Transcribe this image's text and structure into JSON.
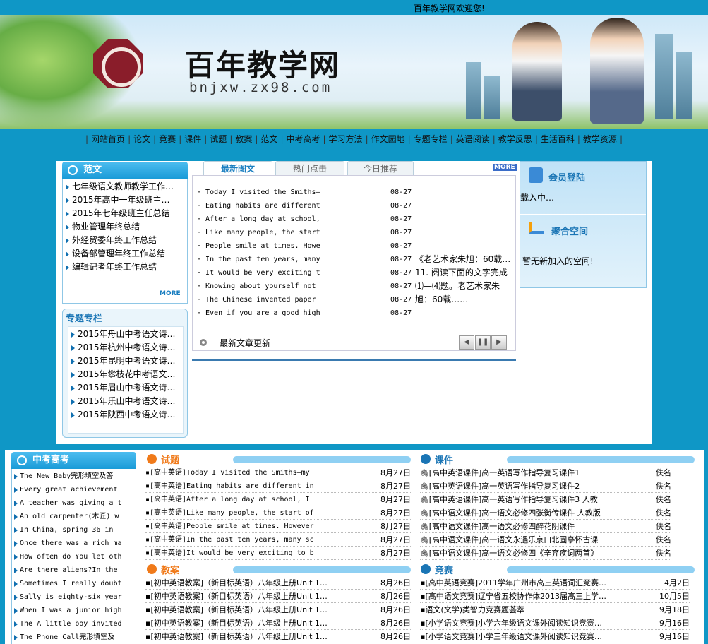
{
  "header": {
    "welcome": "百年教学网欢迎您!",
    "site_title": "百年教学网",
    "site_url": "bnjxw.zx98.com"
  },
  "nav": [
    "网站首页",
    "论文",
    "竞赛",
    "课件",
    "试题",
    "教案",
    "范文",
    "中考高考",
    "学习方法",
    "作文园地",
    "专题专栏",
    "英语阅读",
    "教学反思",
    "生活百科",
    "教学资源"
  ],
  "fanwen": {
    "title": "范文",
    "more": "MORE",
    "items": [
      "七年级语文教师教学工作…",
      "2015年高中一年级班主任…",
      "2015年七年级班主任总结",
      "物业管理年终总结",
      "外经贸委年终工作总结",
      "设备部管理年终工作总结",
      "编辑记者年终工作总结"
    ]
  },
  "zhuanti": {
    "title": "专题专栏",
    "items": [
      "2015年舟山中考语文诗词…",
      "2015年杭州中考语文诗词…",
      "2015年昆明中考语文诗词…",
      "2015年攀枝花中考语文诗…",
      "2015年眉山中考语文诗词…",
      "2015年乐山中考语文诗词…",
      "2015年陕西中考语文诗词…"
    ]
  },
  "tabs": [
    "最新图文",
    "热门点击",
    "今日推荐"
  ],
  "tab_more": "MORE",
  "news": {
    "items": [
      {
        "title": "Today I visited the Smiths—",
        "date": "08-27"
      },
      {
        "title": "Eating habits are different",
        "date": "08-27"
      },
      {
        "title": "After a long day at school,",
        "date": "08-27"
      },
      {
        "title": "Like many people, the start",
        "date": "08-27"
      },
      {
        "title": "People smile at times. Howe",
        "date": "08-27"
      },
      {
        "title": "In the past ten years, many",
        "date": "08-27"
      },
      {
        "title": "It would be very exciting t",
        "date": "08-27"
      },
      {
        "title": "Knowing about yourself not",
        "date": "08-27"
      },
      {
        "title": "The Chinese invented paper",
        "date": "08-27"
      },
      {
        "title": "Even if you are a good high",
        "date": "08-27"
      }
    ],
    "side_text": [
      "《老艺术家朱旭：60载…",
      "11. 阅读下面的文字完成",
      "⑴—⑷题。老艺术家朱",
      "旭：60载……"
    ],
    "footer": "最新文章更新",
    "ctrl_prev": "◀",
    "ctrl_pause": "❚❚",
    "ctrl_next": "▶"
  },
  "member": {
    "title": "会员登陆",
    "loading": "载入中…",
    "space_title": "聚合空间",
    "space_empty": "暂无新加入的空间!"
  },
  "zhongkao": {
    "title": "中考高考",
    "items": [
      "The New Baby完形填空及答",
      "Every great achievement",
      "A teacher was giving a t",
      "An old carpenter(木匠) w",
      "In China, spring  36  in",
      "Once there was a rich ma",
      "How often do You let oth",
      "Are there aliens?In the",
      "Sometimes I really doubt",
      "Sally is eighty-six year",
      "When I was a junior high",
      "The A little boy invited",
      "The Phone Call完形填空及"
    ]
  },
  "shiti": {
    "title": "试题",
    "items": [
      {
        "title": "▪[高中英语]Today I visited the Smiths—my",
        "date": "8月27日"
      },
      {
        "title": "▪[高中英语]Eating habits are different in",
        "date": "8月27日"
      },
      {
        "title": "▪[高中英语]After a long day at school, I",
        "date": "8月27日"
      },
      {
        "title": "▪[高中英语]Like many people, the start of",
        "date": "8月27日"
      },
      {
        "title": "▪[高中英语]People smile at times. However",
        "date": "8月27日"
      },
      {
        "title": "▪[高中英语]In the past ten years, many sc",
        "date": "8月27日"
      },
      {
        "title": "▪[高中英语]It would be very exciting to b",
        "date": "8月27日"
      }
    ]
  },
  "kejian": {
    "title": "课件",
    "items": [
      {
        "title": "[高中英语课件]高一英语写作指导复习课件1",
        "author": "佚名"
      },
      {
        "title": "[高中英语课件]高一英语写作指导复习课件2",
        "author": "佚名"
      },
      {
        "title": "[高中英语课件]高一英语写作指导复习课件3 人教",
        "author": "佚名"
      },
      {
        "title": "[高中语文课件]高一语文必修四张衡传课件 人教版",
        "author": "佚名"
      },
      {
        "title": "[高中语文课件]高一语文必修四醉花阴课件",
        "author": "佚名"
      },
      {
        "title": "[高中语文课件]高一语文永遇乐京口北固亭怀古课",
        "author": "佚名"
      },
      {
        "title": "[高中语文课件]高一语文必修四《辛弃疾词两首》",
        "author": "佚名"
      }
    ]
  },
  "jiaoan": {
    "title": "教案",
    "items": [
      {
        "title": "▪[初中英语教案]（新目标英语）八年级上册Unit 1…",
        "date": "8月26日"
      },
      {
        "title": "▪[初中英语教案]（新目标英语）八年级上册Unit 1…",
        "date": "8月26日"
      },
      {
        "title": "▪[初中英语教案]（新目标英语）八年级上册Unit 1…",
        "date": "8月26日"
      },
      {
        "title": "▪[初中英语教案]（新目标英语）八年级上册Unit 1…",
        "date": "8月26日"
      },
      {
        "title": "▪[初中英语教案]（新目标英语）八年级上册Unit 1…",
        "date": "8月26日"
      }
    ]
  },
  "jingsai": {
    "title": "竞赛",
    "items": [
      {
        "title": "▪[高中英语竞赛]2011学年广州市高三英语词汇竞赛…",
        "date": "4月2日"
      },
      {
        "title": "▪[高中语文竞赛]辽宁省五校协作体2013届高三上学…",
        "date": "10月5日"
      },
      {
        "title": "▪语文(文学)类智力竞赛题荟萃",
        "date": "9月18日"
      },
      {
        "title": "▪[小学语文竞赛]小学六年级语文课外阅读知识竞赛…",
        "date": "9月16日"
      },
      {
        "title": "▪[小学语文竞赛]小学三年级语文课外阅读知识竞赛…",
        "date": "9月16日"
      }
    ]
  }
}
